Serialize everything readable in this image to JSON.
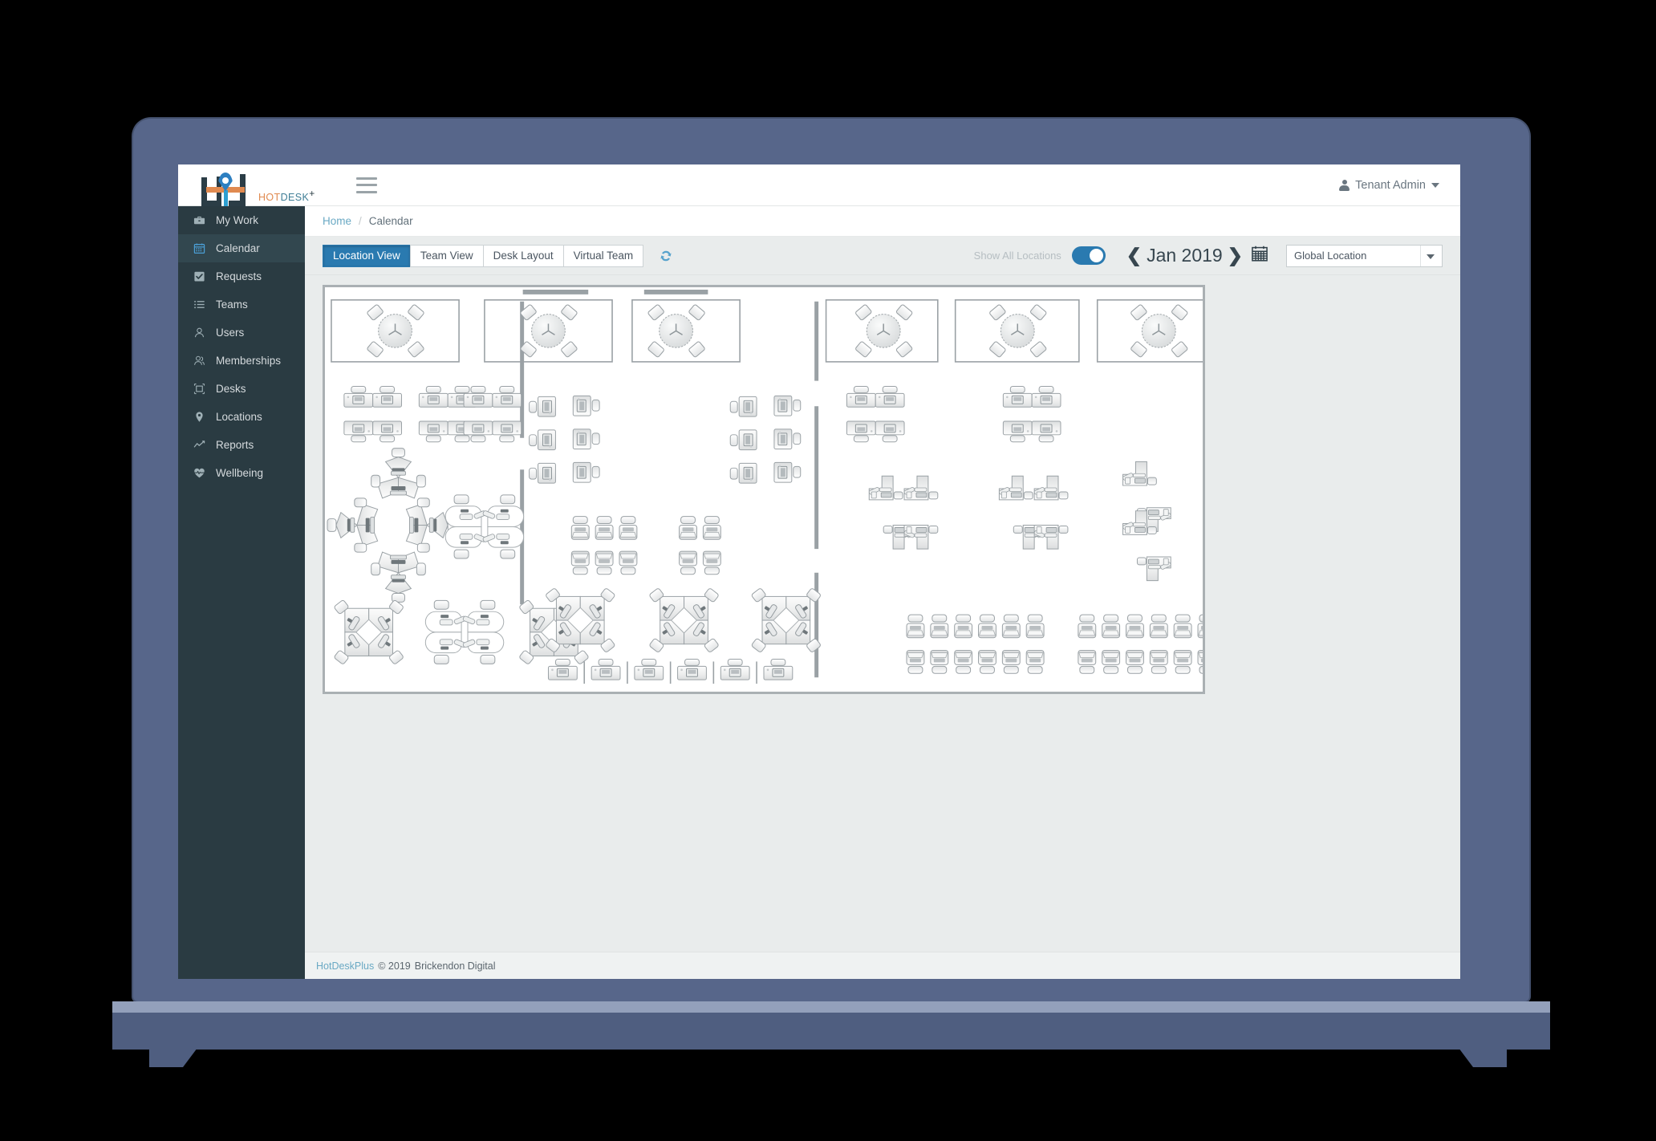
{
  "app": {
    "logo_hot": "HOT",
    "logo_desk": "DESK",
    "logo_plus": "+",
    "hamburger_icon": "hamburger-menu-icon"
  },
  "header": {
    "user_name": "Tenant Admin",
    "user_icon": "user-icon",
    "caret_icon": "chevron-down-icon"
  },
  "sidebar": {
    "items": [
      {
        "label": "My Work",
        "icon": "briefcase-icon",
        "active": false
      },
      {
        "label": "Calendar",
        "icon": "calendar-icon",
        "active": true
      },
      {
        "label": "Requests",
        "icon": "checkbox-icon",
        "active": false
      },
      {
        "label": "Teams",
        "icon": "list-icon",
        "active": false
      },
      {
        "label": "Users",
        "icon": "user-icon",
        "active": false
      },
      {
        "label": "Memberships",
        "icon": "users-group-icon",
        "active": false
      },
      {
        "label": "Desks",
        "icon": "desk-frame-icon",
        "active": false
      },
      {
        "label": "Locations",
        "icon": "map-pin-icon",
        "active": false
      },
      {
        "label": "Reports",
        "icon": "line-chart-icon",
        "active": false
      },
      {
        "label": "Wellbeing",
        "icon": "heartbeat-icon",
        "active": false
      }
    ]
  },
  "breadcrumb": {
    "home": "Home",
    "separator": "/",
    "current": "Calendar"
  },
  "toolbar": {
    "tabs": [
      {
        "label": "Location View",
        "active": true
      },
      {
        "label": "Team View",
        "active": false
      },
      {
        "label": "Desk Layout",
        "active": false
      },
      {
        "label": "Virtual Team",
        "active": false
      }
    ],
    "refresh_icon": "refresh-icon",
    "show_all_locations_label": "Show All Locations",
    "show_all_locations_on": true,
    "prev_arrow": "❮",
    "month_label": "Jan 2019",
    "next_arrow": "❯",
    "calendar_icon": "calendar-icon",
    "location_select_value": "Global Location",
    "location_select_caret": "chevron-down-icon"
  },
  "floorplan": {
    "name": "office-floor-plan",
    "zones": 3,
    "meeting_rooms": 6,
    "description": "Office floor plan with meeting rooms, desk pods and bench desks"
  },
  "footer": {
    "brand": "HotDeskPlus",
    "copyright": "© 2019",
    "company": "Brickendon Digital"
  },
  "colors": {
    "accent": "#2a7ab0",
    "sidebar_bg": "#2a3b42",
    "link": "#6aa9c4",
    "logo_orange": "#e08a50",
    "logo_teal": "#3f7e96"
  }
}
